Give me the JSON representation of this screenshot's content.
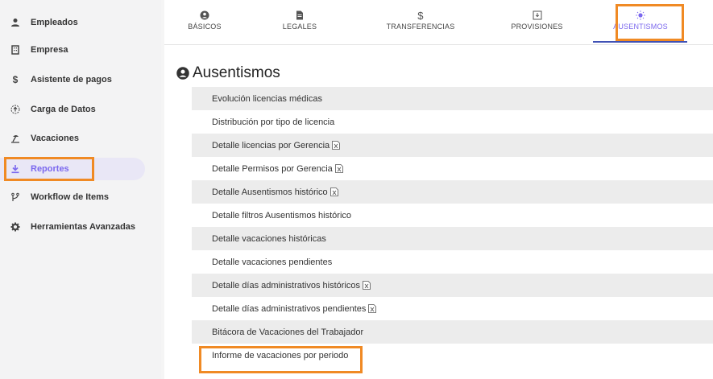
{
  "sidebar": {
    "items": [
      {
        "label": "Empleados",
        "icon": "user-icon"
      },
      {
        "label": "Empresa",
        "icon": "building-icon"
      },
      {
        "label": "Asistente de pagos",
        "icon": "dollar-icon"
      },
      {
        "label": "Carga de Datos",
        "icon": "upload-circle-icon"
      },
      {
        "label": "Vacaciones",
        "icon": "beach-icon"
      },
      {
        "label": "Reportes",
        "icon": "download-icon",
        "active": true
      },
      {
        "label": "Workflow de Items",
        "icon": "branch-icon"
      },
      {
        "label": "Herramientas Avanzadas",
        "icon": "gear-icon"
      }
    ]
  },
  "tabs": [
    {
      "label": "BÁSICOS",
      "icon": "user-circle-icon"
    },
    {
      "label": "LEGALES",
      "icon": "document-icon"
    },
    {
      "label": "TRANSFERENCIAS",
      "icon": "dollar-icon"
    },
    {
      "label": "PROVISIONES",
      "icon": "tray-download-icon"
    },
    {
      "label": "AUSENTISMOS",
      "icon": "sun-icon",
      "active": true
    }
  ],
  "page": {
    "title": "Ausentismos"
  },
  "reports": [
    {
      "label": "Evolución licencias médicas",
      "excel": false
    },
    {
      "label": "Distribución por tipo de licencia",
      "excel": false
    },
    {
      "label": "Detalle licencias por Gerencia",
      "excel": true
    },
    {
      "label": "Detalle Permisos por Gerencia",
      "excel": true
    },
    {
      "label": "Detalle Ausentismos histórico",
      "excel": true
    },
    {
      "label": "Detalle filtros Ausentismos histórico",
      "excel": false
    },
    {
      "label": "Detalle vacaciones históricas",
      "excel": false
    },
    {
      "label": "Detalle vacaciones pendientes",
      "excel": false
    },
    {
      "label": "Detalle días administrativos históricos",
      "excel": true
    },
    {
      "label": "Detalle días administrativos pendientes",
      "excel": true
    },
    {
      "label": "Bitácora de Vacaciones del Trabajador",
      "excel": false
    },
    {
      "label": "Informe de vacaciones por periodo",
      "excel": false
    }
  ],
  "colors": {
    "accent": "#7b68ee",
    "highlight": "#f08a24",
    "tab_underline": "#3f51b5"
  }
}
